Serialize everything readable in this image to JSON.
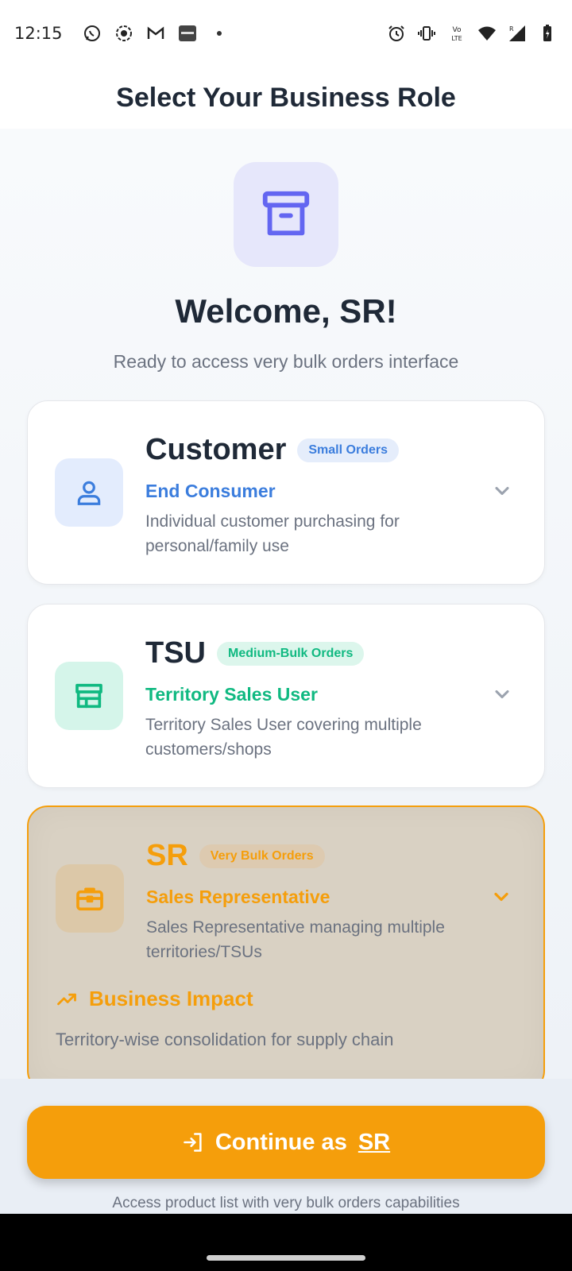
{
  "status_bar": {
    "time": "12:15",
    "left_icons": [
      "whatsapp-icon",
      "record-icon",
      "gmail-icon",
      "paytm-icon",
      "dot-icon"
    ],
    "right_icons": [
      "alarm-icon",
      "vibrate-icon",
      "volte-icon",
      "wifi-icon",
      "signal-icon",
      "battery-icon"
    ],
    "volte_label": "Vo LTE"
  },
  "header": {
    "title": "Select Your Business Role"
  },
  "welcome": {
    "title": "Welcome, SR!",
    "subtitle": "Ready to access very bulk orders interface"
  },
  "roles": [
    {
      "title": "Customer",
      "badge": "Small Orders",
      "subtitle": "End Consumer",
      "description": "Individual customer purchasing for personal/family use",
      "icon": "user-icon",
      "accent": "#3b7ddd",
      "icon_bg": "#e3ecfd",
      "badge_bg": "#e5edfb"
    },
    {
      "title": "TSU",
      "badge": "Medium-Bulk Orders",
      "subtitle": "Territory Sales User",
      "description": "Territory Sales User covering multiple customers/shops",
      "icon": "store-icon",
      "accent": "#10b981",
      "icon_bg": "#d5f5ea",
      "badge_bg": "#dcf6ec"
    },
    {
      "title": "SR",
      "badge": "Very Bulk Orders",
      "subtitle": "Sales Representative",
      "description": "Sales Representative managing multiple territories/TSUs",
      "icon": "briefcase-icon",
      "accent": "#f59e0b",
      "icon_bg": "#dcc8a8",
      "badge_bg": "#ddcab0",
      "selected": true,
      "impact_title": "Business Impact",
      "impact_text": "Territory-wise consolidation for supply chain"
    }
  ],
  "footer": {
    "button_prefix": "Continue as",
    "button_role": "SR",
    "note": "Access product list with very bulk orders capabilities"
  },
  "colors": {
    "primary_text": "#1f2937",
    "muted_text": "#6b7280",
    "accent_sr": "#f59e0b",
    "logo_bg": "#e6e7fb",
    "logo_icon": "#6366f1"
  }
}
